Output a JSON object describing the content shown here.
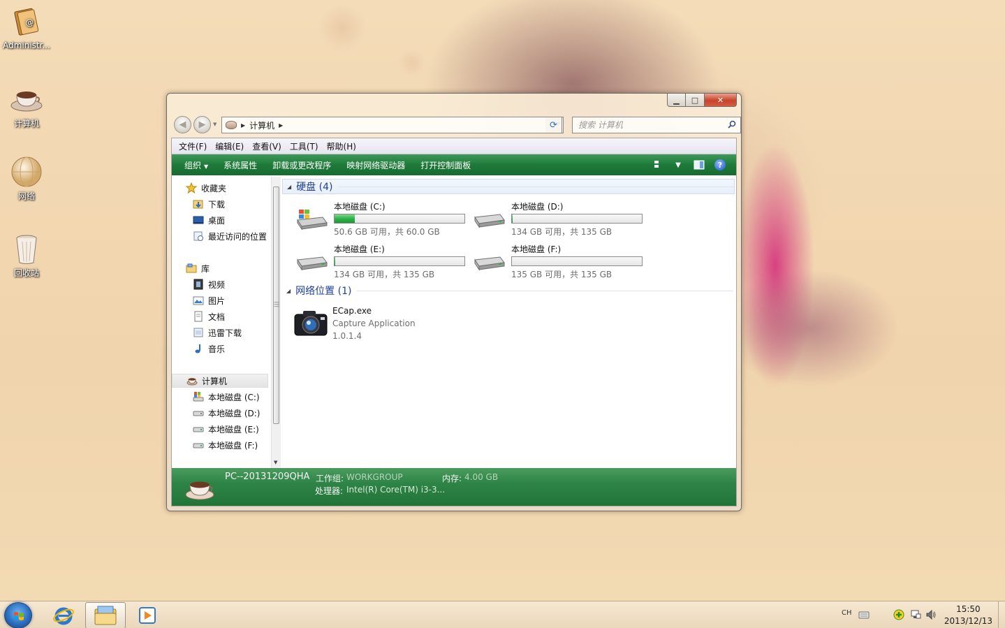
{
  "desktop": {
    "icons": [
      {
        "label": "Administr...",
        "icon": "user-folder-icon"
      },
      {
        "label": "计算机",
        "icon": "computer-icon"
      },
      {
        "label": "网络",
        "icon": "network-icon"
      },
      {
        "label": "回收站",
        "icon": "recycle-bin-icon"
      }
    ]
  },
  "window": {
    "address": {
      "crumb": "计算机"
    },
    "search": {
      "placeholder": "搜索 计算机"
    },
    "menubar": [
      "文件(F)",
      "编辑(E)",
      "查看(V)",
      "工具(T)",
      "帮助(H)"
    ],
    "commands": [
      "组织",
      "系统属性",
      "卸载或更改程序",
      "映射网络驱动器",
      "打开控制面板"
    ],
    "navpane": {
      "favorites": {
        "label": "收藏夹",
        "items": [
          "下载",
          "桌面",
          "最近访问的位置"
        ]
      },
      "libraries": {
        "label": "库",
        "items": [
          "视频",
          "图片",
          "文档",
          "迅雷下载",
          "音乐"
        ]
      },
      "computer": {
        "label": "计算机",
        "items": [
          "本地磁盘 (C:)",
          "本地磁盘 (D:)",
          "本地磁盘 (E:)",
          "本地磁盘 (F:)"
        ]
      }
    },
    "content": {
      "hard_disks_header": "硬盘 (4)",
      "drives": [
        {
          "name": "本地磁盘 (C:)",
          "info": "50.6 GB 可用，共 60.0 GB",
          "used_fraction": 0.157
        },
        {
          "name": "本地磁盘 (D:)",
          "info": "134 GB 可用，共 135 GB",
          "used_fraction": 0.007
        },
        {
          "name": "本地磁盘 (E:)",
          "info": "134 GB 可用，共 135 GB",
          "used_fraction": 0.007
        },
        {
          "name": "本地磁盘 (F:)",
          "info": "135 GB 可用，共 135 GB",
          "used_fraction": 0.0
        }
      ],
      "network_header": "网络位置 (1)",
      "network_item": {
        "name": "ECap.exe",
        "description": "Capture Application",
        "version": "1.0.1.4"
      }
    },
    "details": {
      "computer_name": "PC--20131209QHA",
      "workgroup_label": "工作组:",
      "workgroup_value": "WORKGROUP",
      "memory_label": "内存:",
      "memory_value": "4.00 GB",
      "cpu_label": "处理器:",
      "cpu_value": "Intel(R) Core(TM) i3-3..."
    }
  },
  "taskbar": {
    "ime": "CH",
    "time": "15:50",
    "date": "2013/12/13"
  },
  "colors": {
    "command_bar": "#1f7a3a",
    "group_title": "#1e3f9a",
    "drive_fill": "#2fb34a"
  }
}
